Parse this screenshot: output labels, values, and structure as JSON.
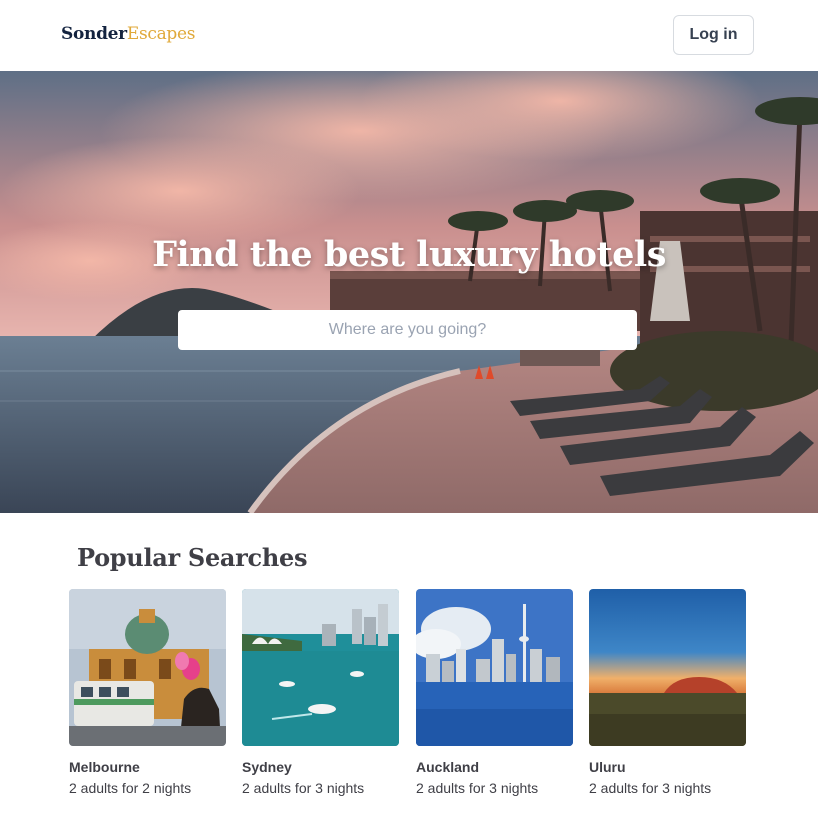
{
  "header": {
    "logo_part1": "Sonder",
    "logo_part2": "Escapes",
    "login_label": "Log in"
  },
  "hero": {
    "title": "Find the best luxury hotels",
    "search_placeholder": "Where are you going?"
  },
  "popular": {
    "title": "Popular Searches",
    "items": [
      {
        "name": "Melbourne",
        "details": "2 adults for 2 nights"
      },
      {
        "name": "Sydney",
        "details": "2 adults for 3 nights"
      },
      {
        "name": "Auckland",
        "details": "2 adults for 3 nights"
      },
      {
        "name": "Uluru",
        "details": "2 adults for 3 nights"
      }
    ]
  },
  "colors": {
    "brand_dark": "#13233f",
    "brand_accent": "#e0a93a"
  }
}
